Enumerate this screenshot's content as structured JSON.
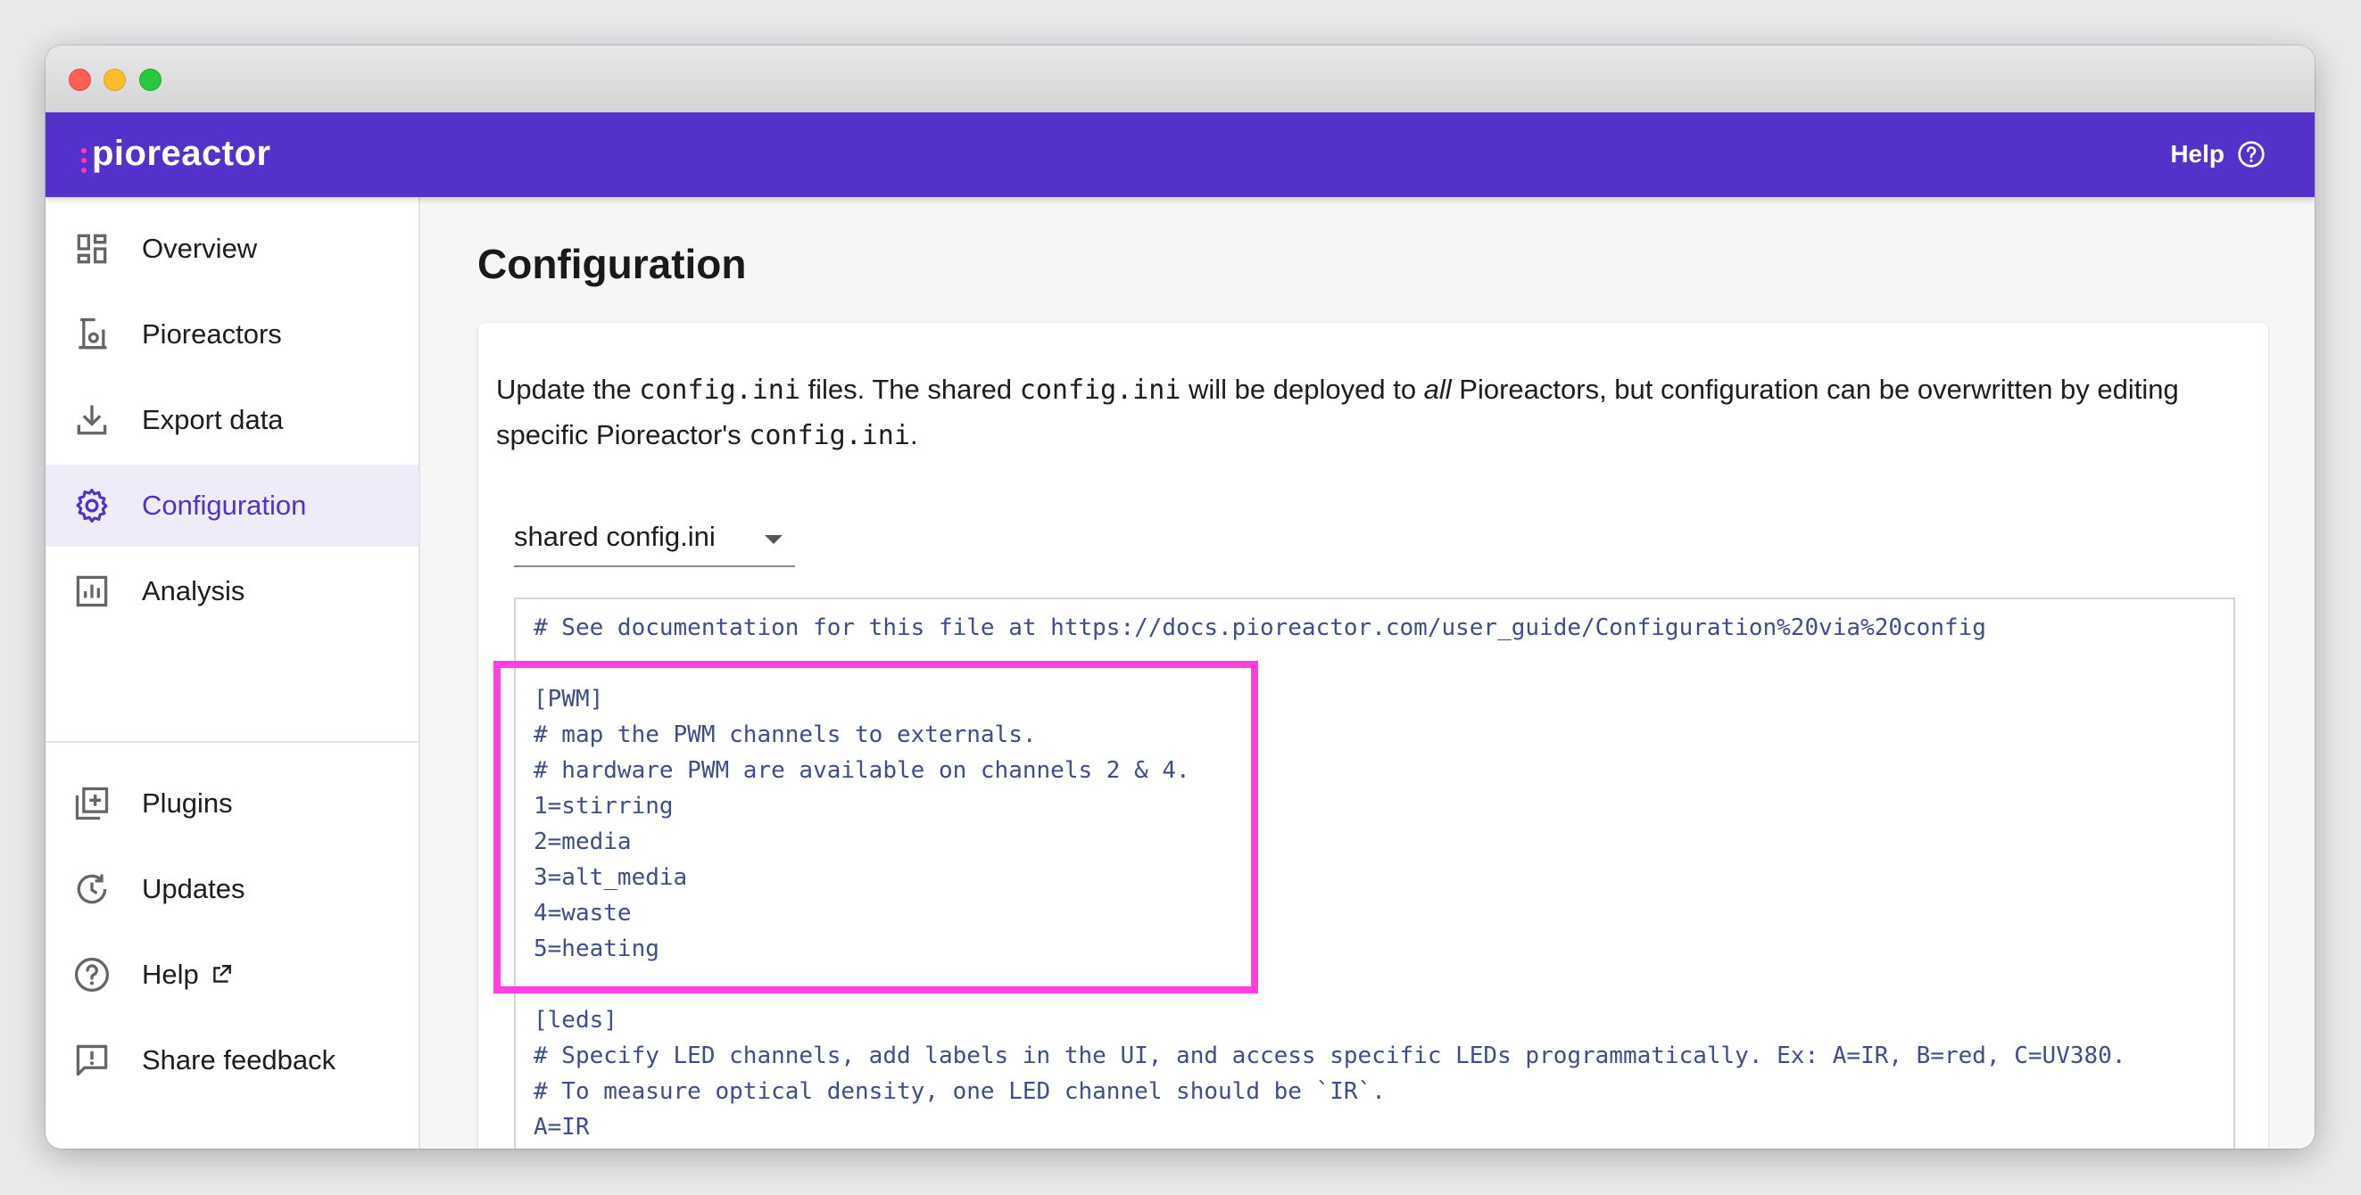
{
  "app": {
    "logo": "pioreactor",
    "help_label": "Help"
  },
  "colors": {
    "brand": "#5331ca",
    "highlight": "#ff3fe0",
    "code_text": "#3e4e8c"
  },
  "sidebar": {
    "items": [
      {
        "label": "Overview",
        "icon": "dashboard-icon",
        "active": false
      },
      {
        "label": "Pioreactors",
        "icon": "pioreactor-icon",
        "active": false
      },
      {
        "label": "Export data",
        "icon": "download-icon",
        "active": false
      },
      {
        "label": "Configuration",
        "icon": "gear-icon",
        "active": true
      },
      {
        "label": "Analysis",
        "icon": "bar-chart-icon",
        "active": false
      },
      {
        "label": "Plugins",
        "icon": "add-box-icon",
        "active": false
      },
      {
        "label": "Updates",
        "icon": "update-icon",
        "active": false
      },
      {
        "label": "Help",
        "icon": "help-circle-icon",
        "active": false,
        "external": true
      },
      {
        "label": "Share feedback",
        "icon": "feedback-icon",
        "active": false
      }
    ]
  },
  "main": {
    "title": "Configuration",
    "description": {
      "part1": "Update the ",
      "code1": "config.ini",
      "part2": " files. The shared ",
      "code2": "config.ini",
      "part3": " will be deployed to ",
      "em": "all",
      "part4": " Pioreactors, but configuration can be overwritten by editing specific Pioreactor's ",
      "code3": "config.ini",
      "part5": "."
    },
    "select": {
      "value": "shared config.ini"
    },
    "editor": {
      "lines": [
        "# See documentation for this file at https://docs.pioreactor.com/user_guide/Configuration%20via%20config",
        "",
        "[PWM]",
        "# map the PWM channels to externals.",
        "# hardware PWM are available on channels 2 & 4.",
        "1=stirring",
        "2=media",
        "3=alt_media",
        "4=waste",
        "5=heating",
        "",
        "[leds]",
        "# Specify LED channels, add labels in the UI, and access specific LEDs programmatically. Ex: A=IR, B=red, C=UV380.",
        "# To measure optical density, one LED channel should be `IR`.",
        "A=IR"
      ]
    }
  }
}
